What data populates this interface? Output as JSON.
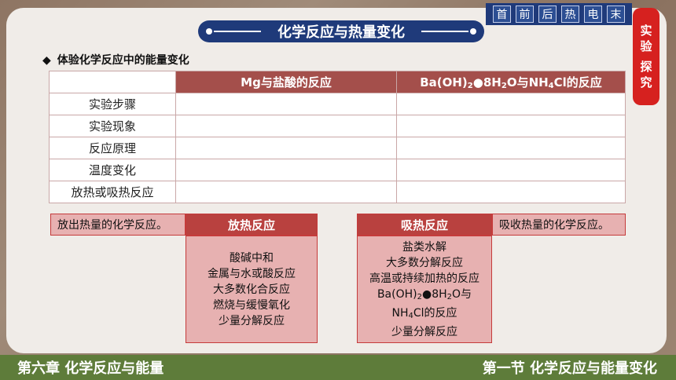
{
  "header": {
    "title": "化学反应与热量变化"
  },
  "nav": {
    "buttons": [
      "首",
      "前",
      "后",
      "热",
      "电",
      "末"
    ]
  },
  "side_tab": {
    "chars": [
      "实",
      "验",
      "探",
      "究"
    ]
  },
  "subtitle": {
    "bullet": "◆",
    "text": "体验化学反应中的能量变化"
  },
  "table": {
    "col1_header": "Mg与盐酸的反应",
    "col2_header": "Ba(OH)₂●8H₂O与NH₄Cl的反应",
    "rows": [
      "实验步骤",
      "实验现象",
      "反应原理",
      "温度变化",
      "放热或吸热反应"
    ]
  },
  "exo": {
    "definition": "放出热量的化学反应。",
    "title": "放热反应",
    "items": [
      "酸碱中和",
      "金属与水或酸反应",
      "大多数化合反应",
      "燃烧与缓慢氧化",
      "少量分解反应"
    ]
  },
  "endo": {
    "title": "吸热反应",
    "definition": "吸收热量的化学反应。",
    "items": [
      "盐类水解",
      "大多数分解反应",
      "高温或持续加热的反应",
      "Ba(OH)₂●8H₂O与",
      "NH₄Cl的反应",
      "少量分解反应"
    ]
  },
  "footer": {
    "left": "第六章  化学反应与能量",
    "right": "第一节  化学反应与能量变化"
  },
  "colors": {
    "title_blue": "#1f3a7a",
    "accent_red": "#b9413f",
    "pink": "#e7b1b1",
    "footer_green": "#5e7c3a",
    "side_red": "#d6211f"
  }
}
